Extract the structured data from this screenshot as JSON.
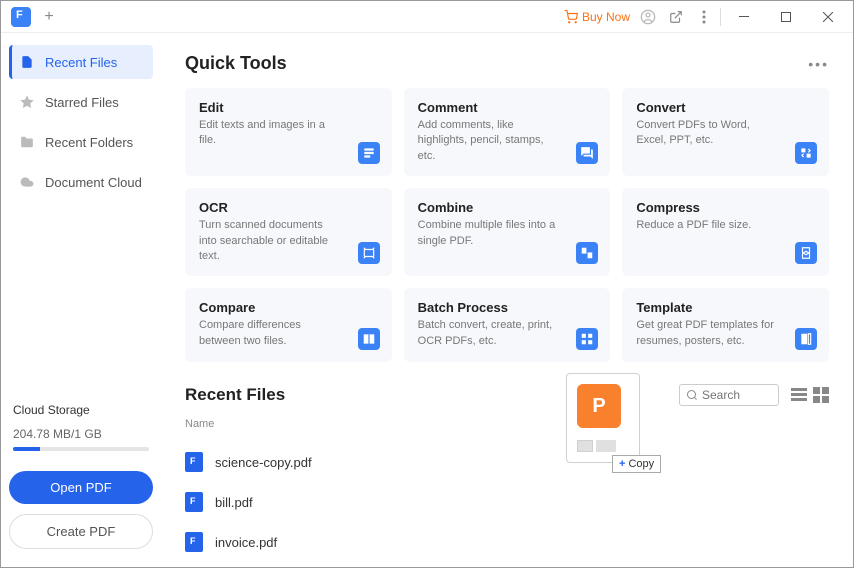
{
  "titlebar": {
    "buy_now": "Buy Now"
  },
  "sidebar": {
    "items": [
      {
        "label": "Recent Files",
        "icon": "file"
      },
      {
        "label": "Starred Files",
        "icon": "star"
      },
      {
        "label": "Recent Folders",
        "icon": "folder"
      },
      {
        "label": "Document Cloud",
        "icon": "cloud"
      }
    ],
    "cloud": {
      "title": "Cloud Storage",
      "usage": "204.78 MB/1 GB"
    },
    "open_btn": "Open PDF",
    "create_btn": "Create PDF"
  },
  "quick_tools": {
    "title": "Quick Tools",
    "tools": [
      {
        "title": "Edit",
        "desc": "Edit texts and images in a file."
      },
      {
        "title": "Comment",
        "desc": "Add comments, like highlights, pencil, stamps, etc."
      },
      {
        "title": "Convert",
        "desc": "Convert PDFs to Word, Excel, PPT, etc."
      },
      {
        "title": "OCR",
        "desc": "Turn scanned documents into searchable or editable text."
      },
      {
        "title": "Combine",
        "desc": "Combine multiple files into a single PDF."
      },
      {
        "title": "Compress",
        "desc": "Reduce a PDF file size."
      },
      {
        "title": "Compare",
        "desc": "Compare differences between two files."
      },
      {
        "title": "Batch Process",
        "desc": "Batch convert, create, print, OCR PDFs, etc."
      },
      {
        "title": "Template",
        "desc": "Get great PDF templates for resumes, posters, etc."
      }
    ]
  },
  "recent": {
    "title": "Recent Files",
    "search_placeholder": "Search",
    "col_name": "Name",
    "files": [
      {
        "name": "science-copy.pdf"
      },
      {
        "name": "bill.pdf"
      },
      {
        "name": "invoice.pdf"
      }
    ]
  },
  "drag": {
    "copy_label": "Copy"
  }
}
